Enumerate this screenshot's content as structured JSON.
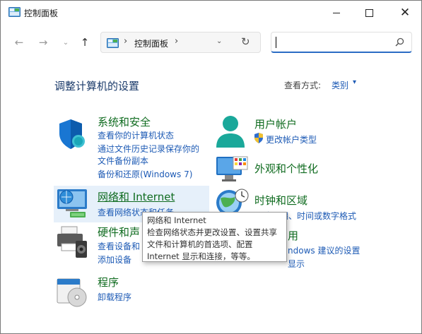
{
  "window": {
    "title": "控制面板",
    "minimize": "minimize",
    "maximize": "maximize",
    "close": "close"
  },
  "nav": {
    "address_path": "控制面板",
    "search_placeholder": ""
  },
  "main": {
    "heading": "调整计算机的设置",
    "view_by_label": "查看方式:",
    "view_by_value": "类别"
  },
  "categories": {
    "security": {
      "title": "系统和安全",
      "links": [
        "查看你的计算机状态",
        "通过文件历史记录保存你的",
        "文件备份副本",
        "备份和还原(Windows 7)"
      ]
    },
    "network": {
      "title": "网络和 Internet",
      "links": [
        "查看网络状态和任务"
      ]
    },
    "hardware": {
      "title": "硬件和声",
      "links": [
        "查看设备和",
        "添加设备"
      ]
    },
    "programs": {
      "title": "程序",
      "links": [
        "卸载程序"
      ]
    },
    "accounts": {
      "title": "用户帐户",
      "links": [
        "更改帐户类型"
      ]
    },
    "appearance": {
      "title": "外观和个性化",
      "links": []
    },
    "clock": {
      "title": "时钟和区域",
      "links": [
        "更改日期、时间或数字格式"
      ]
    },
    "ease": {
      "title": "用",
      "links": [
        "ndows 建议的设置",
        "显示"
      ]
    }
  },
  "tooltip": {
    "lines": [
      "网络和 Internet",
      "检查网络状态并更改设置、设置共享",
      "文件和计算机的首选项、配置",
      "Internet 显示和连接，等等。"
    ]
  },
  "colors": {
    "category_title": "#0f6b1f",
    "link": "#1e5bb5",
    "hover": "#e6f0fa",
    "search_focus": "#2b6cc4"
  }
}
